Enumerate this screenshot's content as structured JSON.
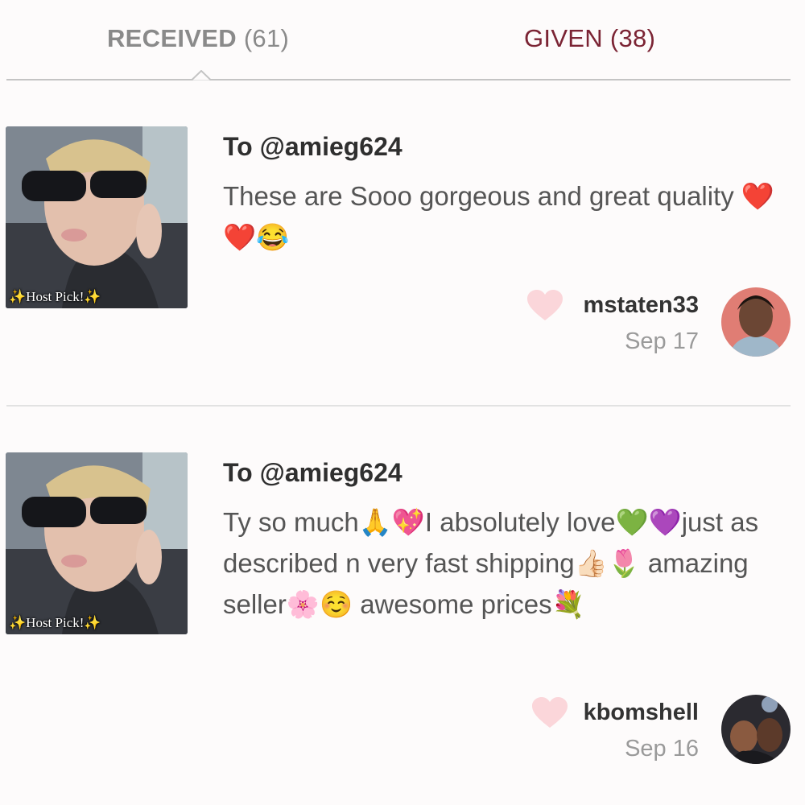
{
  "tabs": {
    "received": {
      "label": "RECEIVED",
      "count": "(61)"
    },
    "given": {
      "label": "GIVEN",
      "count": "(38)"
    }
  },
  "colors": {
    "accent": "#7b2434",
    "heart": "#fbd6da",
    "tab_inactive": "#8a8a8a"
  },
  "reviews": [
    {
      "recipient": "To @amieg624",
      "text": "These are Sooo gorgeous and great quality ❤️❤️😂",
      "listing_badge": "✨Host Pick!✨",
      "reviewer": "mstaten33",
      "date": "Sep 17",
      "icon": "heart-icon"
    },
    {
      "recipient": "To @amieg624",
      "text": "Ty so much🙏💖I absolutely love💚💜just as described n very fast shipping👍🏻🌷 amazing seller🌸☺️ awesome prices💐",
      "listing_badge": "✨Host Pick!✨",
      "reviewer": "kbomshell",
      "date": "Sep 16",
      "icon": "heart-icon"
    }
  ]
}
